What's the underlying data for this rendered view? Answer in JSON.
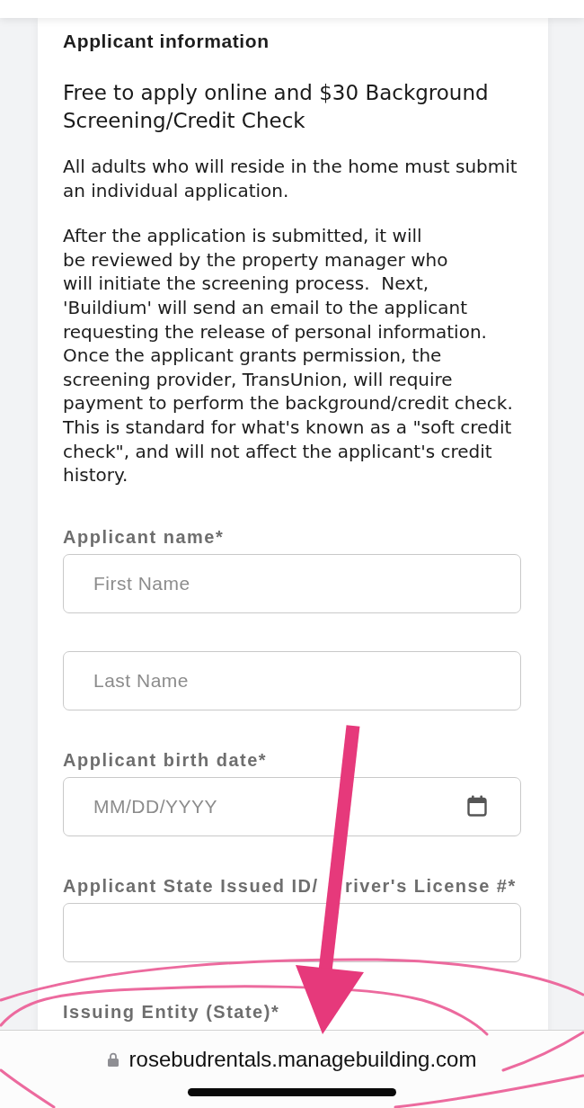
{
  "section": {
    "title": "Applicant information",
    "heading": "Free to apply online and $30 Background Screening/Credit Check",
    "paragraphs": [
      "All adults who will reside in the home must submit an individual application.",
      "After the application is submitted, it will\nbe reviewed by the property manager who\nwill initiate the screening process.  Next, 'Buildium' will send an email to the applicant requesting the release of personal information. Once the applicant grants permission, the screening provider, TransUnion, will require payment to perform the background/credit check. This is standard for what's known as a \"soft credit check\", and will not affect the applicant's credit history."
    ]
  },
  "fields": [
    {
      "label": "Applicant name*",
      "inputs": [
        {
          "kind": "text",
          "placeholder": "First Name"
        },
        {
          "kind": "text",
          "placeholder": "Last Name"
        }
      ]
    },
    {
      "label": "Applicant birth date*",
      "inputs": [
        {
          "kind": "date",
          "placeholder": "MM/DD/YYYY"
        }
      ]
    },
    {
      "label": "Applicant State Issued ID/",
      "label_after_arrow": "river's License #*",
      "inputs": [
        {
          "kind": "text"
        }
      ]
    },
    {
      "label": "Issuing Entity (State)*"
    }
  ],
  "address_bar": {
    "url": "rosebudrentals.managebuilding.com"
  }
}
